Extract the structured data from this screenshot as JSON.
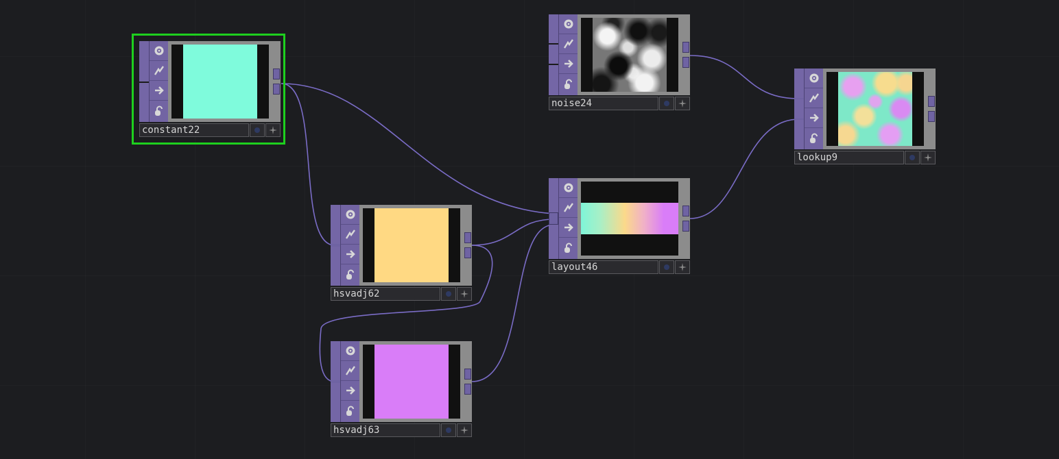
{
  "canvas": {
    "background": "#1c1d20",
    "wire_color": "#7a6cc6",
    "selection_color": "#1ed01e"
  },
  "icons": [
    "viewer-toggle-icon",
    "cook-lightning-icon",
    "bypass-arrow-icon",
    "lock-icon"
  ],
  "nodes": [
    {
      "id": "constant22",
      "name": "constant22",
      "selected": true,
      "preview": "solid",
      "color": "#7ffbdc"
    },
    {
      "id": "noise24",
      "name": "noise24",
      "selected": false,
      "preview": "noise"
    },
    {
      "id": "lookup9",
      "name": "lookup9",
      "selected": false,
      "preview": "lookup"
    },
    {
      "id": "layout46",
      "name": "layout46",
      "selected": false,
      "preview": "gradient-strip"
    },
    {
      "id": "hsvadj62",
      "name": "hsvadj62",
      "selected": false,
      "preview": "solid",
      "color": "#ffd983"
    },
    {
      "id": "hsvadj63",
      "name": "hsvadj63",
      "selected": false,
      "preview": "solid",
      "color": "#d97df8"
    }
  ],
  "connections": [
    {
      "from": "constant22",
      "to": "layout46"
    },
    {
      "from": "constant22",
      "to": "hsvadj62"
    },
    {
      "from": "hsvadj62",
      "to": "layout46"
    },
    {
      "from": "hsvadj62",
      "to": "hsvadj63"
    },
    {
      "from": "hsvadj63",
      "to": "layout46"
    },
    {
      "from": "noise24",
      "to": "lookup9"
    },
    {
      "from": "layout46",
      "to": "lookup9"
    }
  ]
}
